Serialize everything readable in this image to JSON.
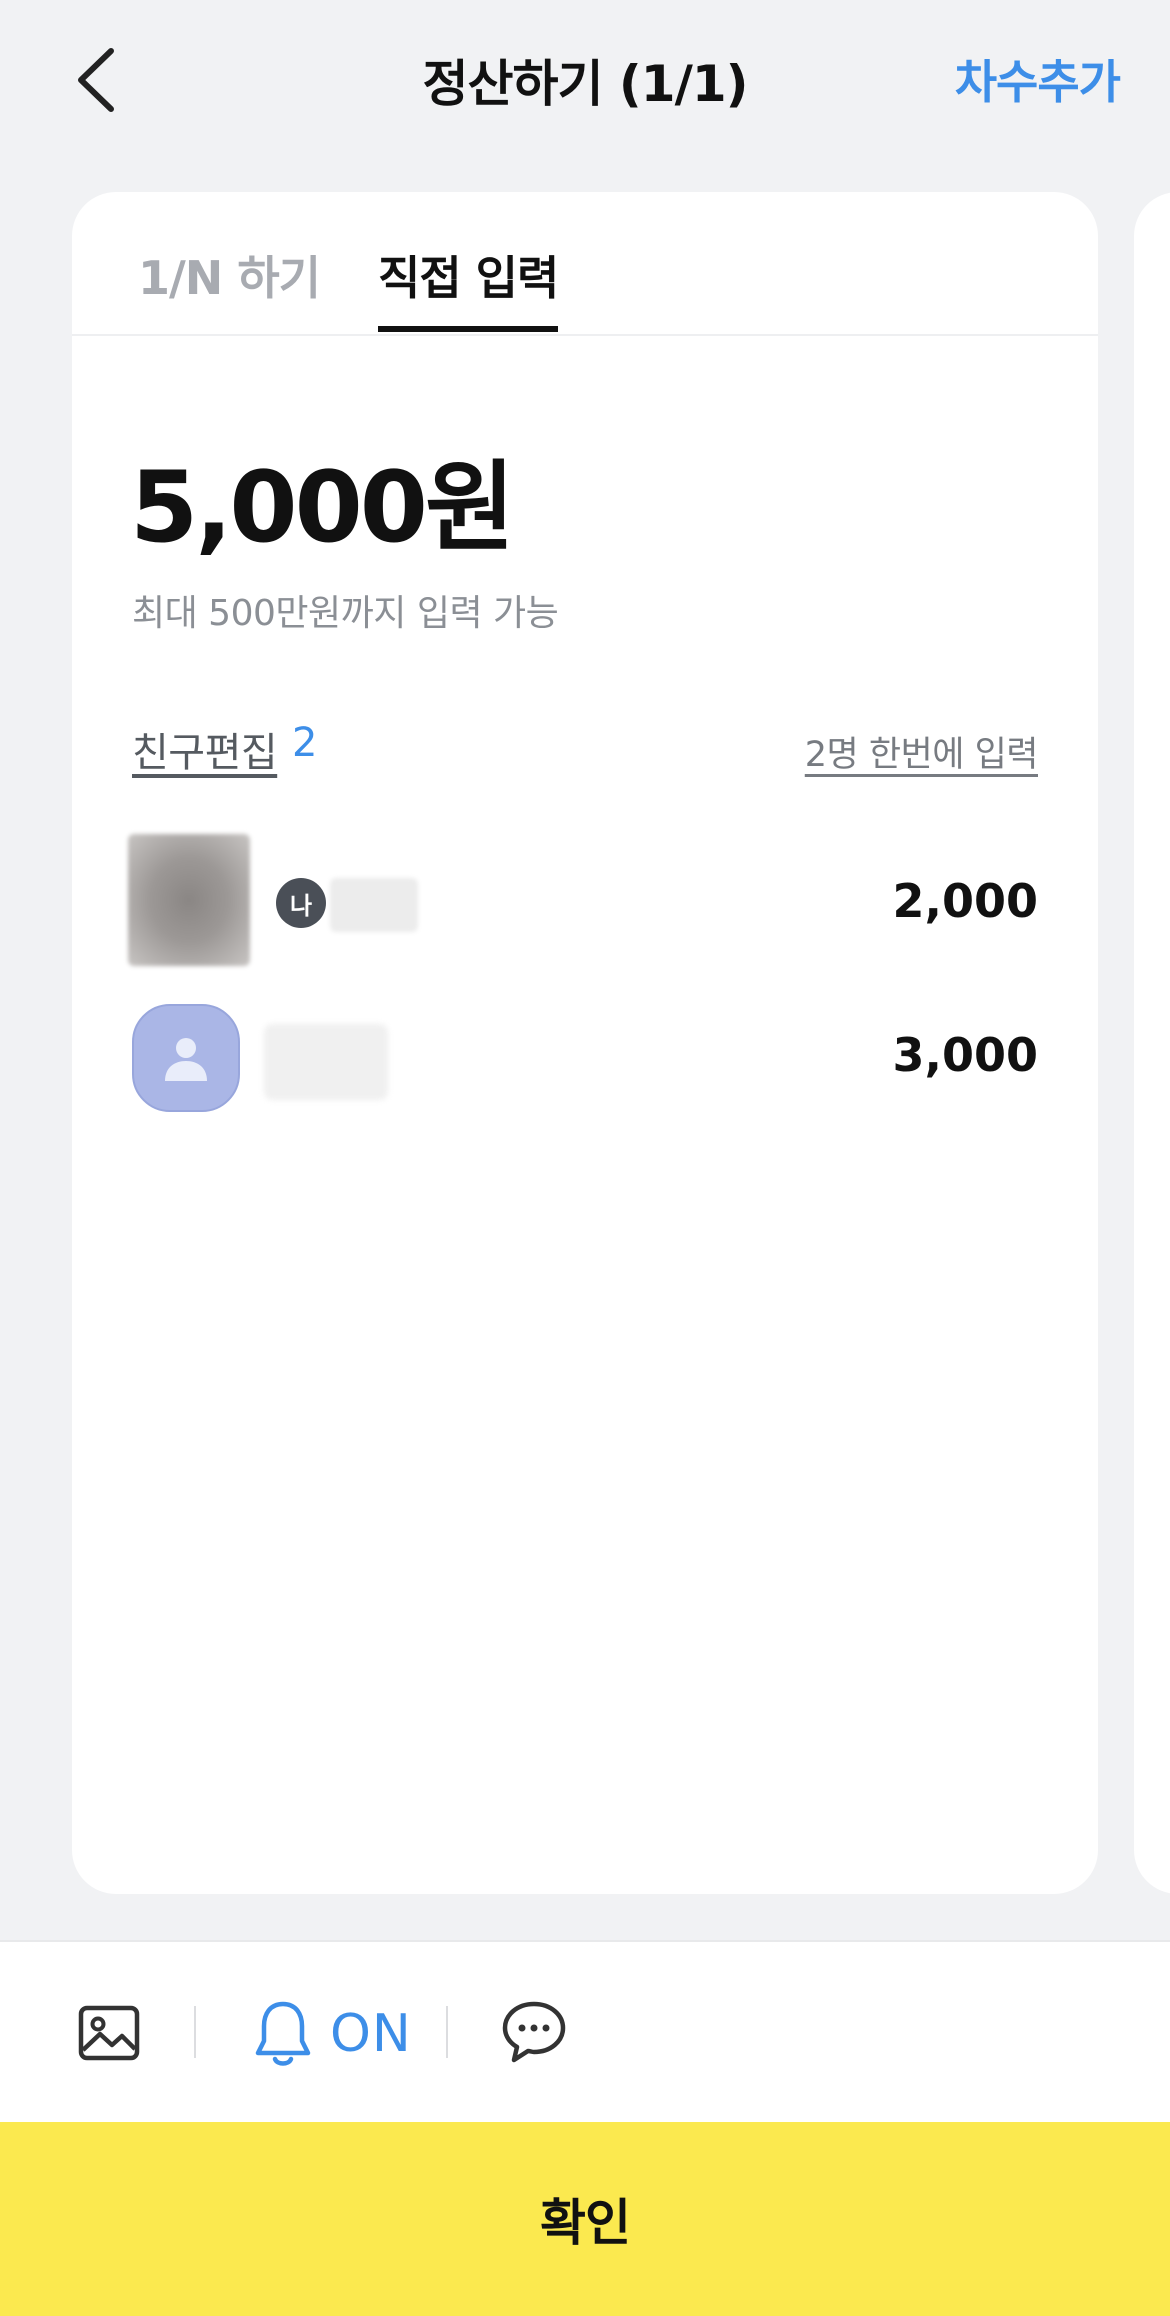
{
  "header": {
    "title": "정산하기 (1/1)",
    "add_round_label": "차수추가"
  },
  "tabs": [
    {
      "label": "1/N 하기",
      "selected": false
    },
    {
      "label": "직접 입력",
      "selected": true
    }
  ],
  "amount": {
    "total": "5,000원",
    "limit_note": "최대 500만원까지 입력 가능"
  },
  "friends": {
    "edit_label": "친구편집",
    "count": "2",
    "bulk_input_label": "2명 한번에 입력",
    "list": [
      {
        "me_badge": "나",
        "amount": "2,000"
      },
      {
        "amount": "3,000"
      }
    ]
  },
  "toolbar": {
    "notification_label": "ON"
  },
  "confirm_label": "확인",
  "colors": {
    "accent": "#3d8ee8",
    "confirm_bg": "#fbe94f",
    "background": "#f1f2f4"
  }
}
